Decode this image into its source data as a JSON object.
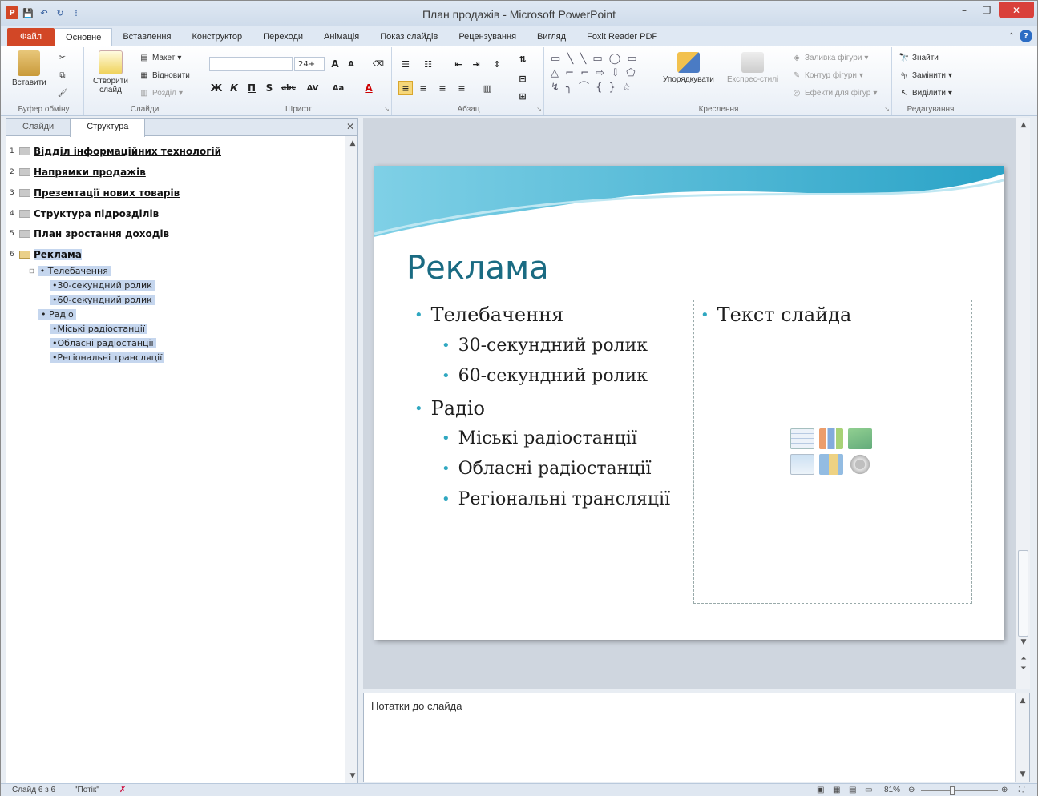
{
  "window": {
    "title": "План продажів - Microsoft PowerPoint",
    "controls": {
      "minimize": "–",
      "restore": "❐",
      "close": "✕"
    }
  },
  "quick_access": [
    "P",
    "💾",
    "↶",
    "↻",
    "⁞"
  ],
  "tabs": [
    "Файл",
    "Основне",
    "Вставлення",
    "Конструктор",
    "Переходи",
    "Анімація",
    "Показ слайдів",
    "Рецензування",
    "Вигляд",
    "Foxit Reader PDF"
  ],
  "ribbon": {
    "clipboard": {
      "label": "Буфер обміну",
      "paste": "Вставити"
    },
    "slides": {
      "label": "Слайди",
      "new_slide": "Створити слайд",
      "layout": "Макет",
      "reset": "Відновити",
      "section": "Розділ"
    },
    "font": {
      "label": "Шрифт",
      "font_name": "",
      "font_size": "24+",
      "bold": "Ж",
      "italic": "К",
      "underline": "П",
      "shadow": "S",
      "strike": "abc",
      "spacing": "AV",
      "case": "Aa",
      "color": "A"
    },
    "paragraph": {
      "label": "Абзац"
    },
    "drawing": {
      "label": "Креслення",
      "arrange": "Упорядкувати",
      "quick_styles": "Експрес-стилі",
      "fill": "Заливка фігури",
      "outline": "Контур фігури",
      "effects": "Ефекти для фігур"
    },
    "editing": {
      "label": "Редагування",
      "find": "Знайти",
      "replace": "Замінити",
      "select": "Виділити"
    }
  },
  "left_pane": {
    "tabs": [
      "Слайди",
      "Структура"
    ],
    "close": "✕",
    "outline": [
      {
        "num": "1",
        "title": "Відділ інформаційних технологій",
        "underline": true
      },
      {
        "num": "2",
        "title": "Напрямки продажів",
        "underline": true
      },
      {
        "num": "3",
        "title": "Презентації нових товарів",
        "underline": true
      },
      {
        "num": "4",
        "title": "Структура підрозділів",
        "underline": false
      },
      {
        "num": "5",
        "title": "План зростання доходів",
        "underline": false
      },
      {
        "num": "6",
        "title": "Реклама",
        "underline": false,
        "selected": true
      }
    ],
    "bullets": [
      {
        "level": 1,
        "text": "Телебачення"
      },
      {
        "level": 2,
        "text": "30-секундний ролик"
      },
      {
        "level": 2,
        "text": "60-секундний ролик"
      },
      {
        "level": 1,
        "text": "Радіо"
      },
      {
        "level": 2,
        "text": "Міські радіостанції"
      },
      {
        "level": 2,
        "text": "Обласні радіостанції"
      },
      {
        "level": 2,
        "text": "Регіональні трансляції"
      }
    ]
  },
  "slide": {
    "title": "Реклама",
    "bullets": [
      {
        "level": 1,
        "text": "Телебачення"
      },
      {
        "level": 2,
        "text": "30-секундний ролик"
      },
      {
        "level": 2,
        "text": "60-секундний ролик"
      },
      {
        "level": 1,
        "text": "Радіо"
      },
      {
        "level": 2,
        "text": "Міські радіостанції"
      },
      {
        "level": 2,
        "text": "Обласні радіостанції"
      },
      {
        "level": 2,
        "text": "Регіональні трансляції"
      }
    ],
    "placeholder_text": "Текст слайда"
  },
  "notes": {
    "placeholder": "Нотатки до слайда"
  },
  "status": {
    "slide_info": "Слайд 6 з 6",
    "theme": "\"Потік\"",
    "zoom": "81%"
  },
  "colors": {
    "accent": "#d24726",
    "title": "#1a6b82",
    "bullet": "#2fa7c0"
  }
}
